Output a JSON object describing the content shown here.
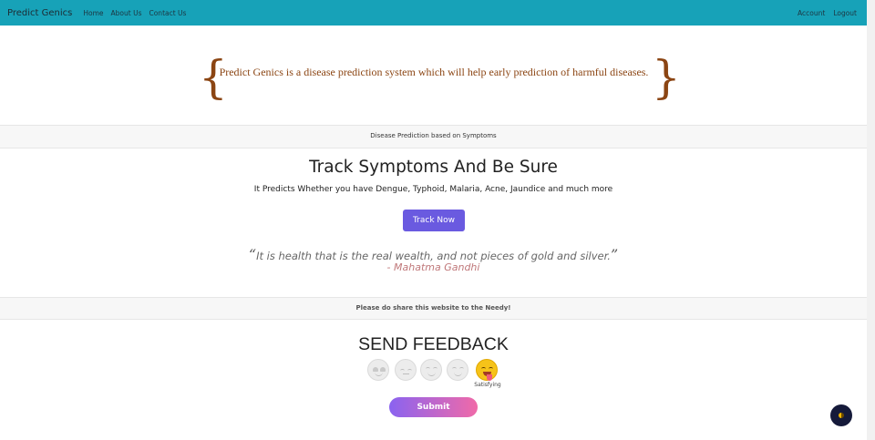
{
  "navbar": {
    "brand": "Predict Genics",
    "links": [
      "Home",
      "About Us",
      "Contact Us"
    ],
    "right_links": [
      "Account",
      "Logout"
    ],
    "bg_color": "#17a2b8"
  },
  "intro": {
    "text": "Predict Genics is a disease prediction system which will help early prediction of harmful diseases.",
    "color": "#8b4513"
  },
  "section_band": {
    "text": "Disease Prediction based on Symptoms"
  },
  "hero": {
    "title": "Track Symptoms And Be Sure",
    "subtitle": "It Predicts Whether you have Dengue, Typhoid, Malaria, Acne, Jaundice and much more",
    "button_label": "Track Now",
    "button_color": "#6a5ae0"
  },
  "quote": {
    "open_mark": "“",
    "text": "It is health that is the real wealth, and not pieces of gold and silver.",
    "close_mark": "”",
    "author": "- Mahatma Gandhi"
  },
  "share_band": {
    "text": "Please do share this website to the Needy!"
  },
  "feedback": {
    "title": "SEND FEEDBACK",
    "faces": [
      "love-face-icon",
      "neutral-face-icon",
      "smile-face-icon",
      "grin-face-icon",
      "tongue-face-icon"
    ],
    "selected_index": 4,
    "selected_label": "Satisfying",
    "submit_label": "Submit"
  },
  "floating_button": {
    "icon": "moon-icon"
  }
}
